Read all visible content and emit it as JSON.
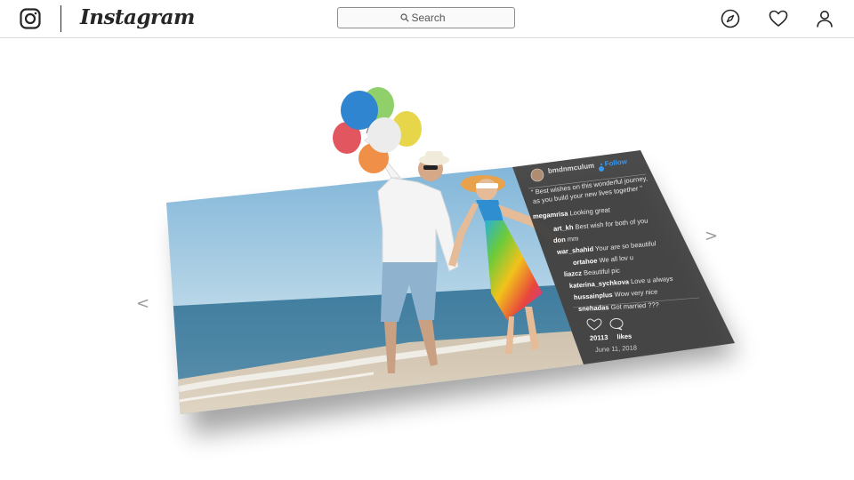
{
  "header": {
    "logo_text": "Instagram",
    "search_placeholder": "Search"
  },
  "icons": {
    "camera": "instagram-camera-icon",
    "search": "magnifier-icon",
    "explore": "compass-icon",
    "activity": "heart-icon",
    "profile": "person-icon"
  },
  "carousel": {
    "prev_label": "<",
    "next_label": ">"
  },
  "post": {
    "username": "bmdnmculum",
    "follow_label": "Follow",
    "caption": "\" Best wishes on this wonderful journey, as you build your new lives together \"",
    "caption_line1": "\" Best wishes on this wonderful journey,",
    "caption_line2": "as you build your new lives together \"",
    "comments": [
      {
        "user": "megamrisa",
        "text": "Looking great"
      },
      {
        "user": "art_kh",
        "text": "Best wish for both of you"
      },
      {
        "user": "don",
        "text": "mm"
      },
      {
        "user": "war_shahid",
        "text": "Your are so beautiful"
      },
      {
        "user": "ortahoe",
        "text": "We all lov u"
      },
      {
        "user": "liazcz",
        "text": "Beautiful pic"
      },
      {
        "user": "katerina_sychkova",
        "text": "Love u always"
      },
      {
        "user": "hussainplus",
        "text": "Wow very nice"
      },
      {
        "user": "snehadas",
        "text": "Got married ???"
      }
    ],
    "likes_count": "20113",
    "likes_label": "likes",
    "date": "June 11, 2018"
  },
  "colors": {
    "panel_bg": "#3d3d3d",
    "follow_blue": "#3897f0",
    "border": "#dbdbdb",
    "text": "#262626"
  }
}
